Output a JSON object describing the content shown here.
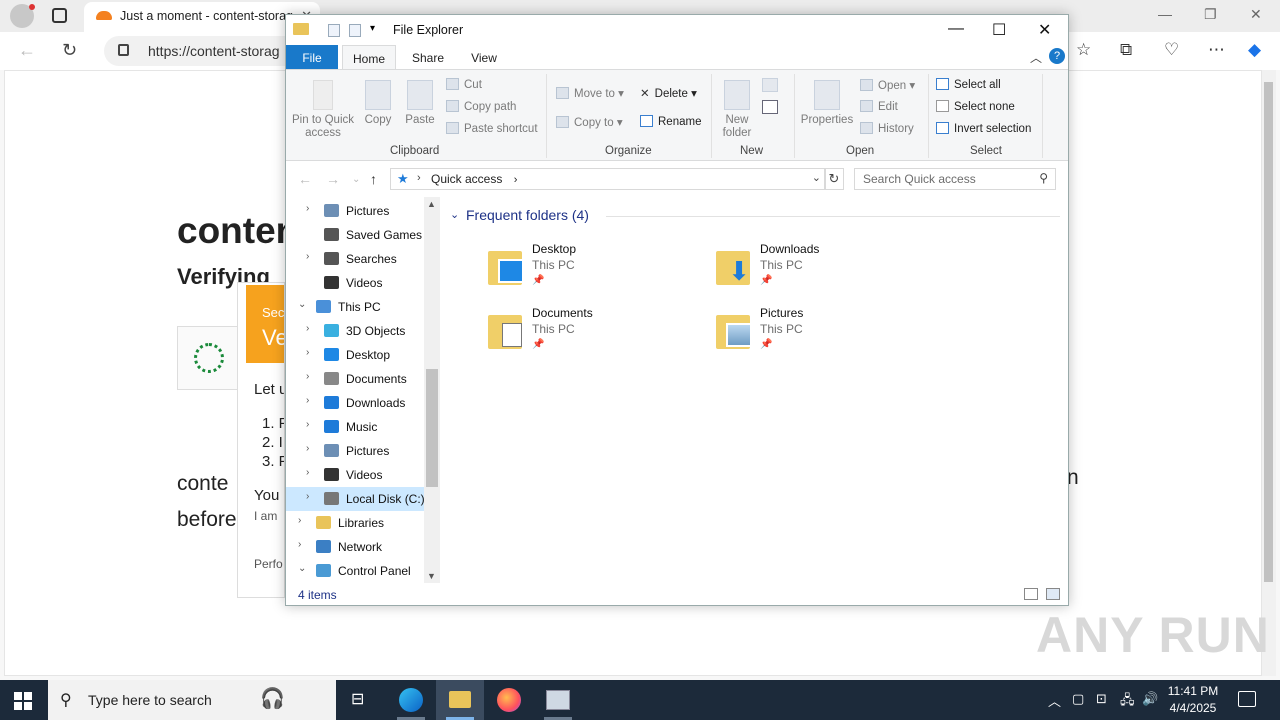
{
  "browser": {
    "tab_title": "Just a moment - content-storag",
    "url": "https://content-storag",
    "page": {
      "heading": "conten",
      "subheading": "Verifying",
      "body_line1": "conte",
      "body_line1_end": "n",
      "body_line2": "before",
      "popup": {
        "banner_line1": "Sec",
        "banner_line2": "Ve",
        "intro": "Let u",
        "steps": [
          "1. P",
          "2. I",
          "3. P"
        ],
        "you": "You",
        "iam": "I am",
        "perf": "Perfo"
      }
    }
  },
  "explorer": {
    "title": "File Explorer",
    "ribbon_tabs": [
      "File",
      "Home",
      "Share",
      "View"
    ],
    "ribbon": {
      "clipboard": {
        "label": "Clipboard",
        "pin": "Pin to Quick access",
        "copy": "Copy",
        "paste": "Paste",
        "cut": "Cut",
        "copy_path": "Copy path",
        "paste_shortcut": "Paste shortcut"
      },
      "organize": {
        "label": "Organize",
        "move_to": "Move to",
        "copy_to": "Copy to",
        "delete": "Delete",
        "rename": "Rename"
      },
      "new": {
        "label": "New",
        "new_folder": "New folder"
      },
      "open": {
        "label": "Open",
        "properties": "Properties",
        "open": "Open",
        "edit": "Edit",
        "history": "History"
      },
      "select": {
        "label": "Select",
        "select_all": "Select all",
        "select_none": "Select none",
        "invert": "Invert selection"
      }
    },
    "address": "Quick access",
    "search_placeholder": "Search Quick access",
    "tree": [
      {
        "label": "Pictures",
        "indent": 2,
        "arrow": "›"
      },
      {
        "label": "Saved Games",
        "indent": 2,
        "arrow": ""
      },
      {
        "label": "Searches",
        "indent": 2,
        "arrow": "›"
      },
      {
        "label": "Videos",
        "indent": 2,
        "arrow": ""
      },
      {
        "label": "This PC",
        "indent": 1,
        "arrow": "⌄"
      },
      {
        "label": "3D Objects",
        "indent": 2,
        "arrow": "›"
      },
      {
        "label": "Desktop",
        "indent": 2,
        "arrow": "›"
      },
      {
        "label": "Documents",
        "indent": 2,
        "arrow": "›"
      },
      {
        "label": "Downloads",
        "indent": 2,
        "arrow": "›"
      },
      {
        "label": "Music",
        "indent": 2,
        "arrow": "›"
      },
      {
        "label": "Pictures",
        "indent": 2,
        "arrow": "›"
      },
      {
        "label": "Videos",
        "indent": 2,
        "arrow": "›"
      },
      {
        "label": "Local Disk (C:)",
        "indent": 2,
        "arrow": "›"
      },
      {
        "label": "Libraries",
        "indent": 1,
        "arrow": "›"
      },
      {
        "label": "Network",
        "indent": 1,
        "arrow": "›"
      },
      {
        "label": "Control Panel",
        "indent": 1,
        "arrow": "⌄"
      }
    ],
    "group_header": "Frequent folders (4)",
    "folders": [
      {
        "name": "Desktop",
        "location": "This PC"
      },
      {
        "name": "Downloads",
        "location": "This PC"
      },
      {
        "name": "Documents",
        "location": "This PC"
      },
      {
        "name": "Pictures",
        "location": "This PC"
      }
    ],
    "status": "4 items"
  },
  "taskbar": {
    "search_placeholder": "Type here to search",
    "time": "11:41 PM",
    "date": "4/4/2025"
  },
  "watermark": "ANY RUN"
}
